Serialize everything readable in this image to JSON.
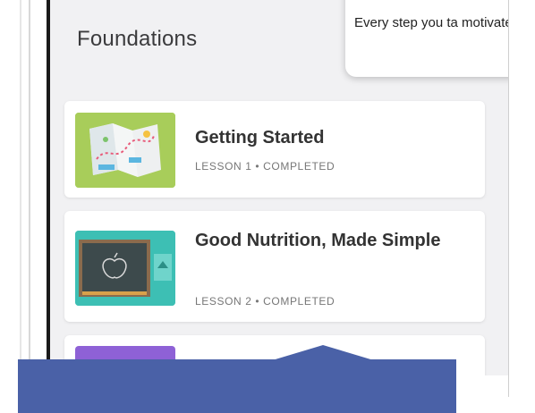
{
  "section": {
    "title": "Foundations"
  },
  "tooltip": {
    "text": "Every step you ta motivate you to g"
  },
  "lessons": [
    {
      "title": "Getting Started",
      "meta": "LESSON 1 • COMPLETED",
      "thumb_color": "#a8cd5a",
      "icon": "map-icon"
    },
    {
      "title": "Good Nutrition, Made Simple",
      "meta": "LESSON 2 • COMPLETED",
      "thumb_color": "#3dbfb4",
      "icon": "chalkboard-icon"
    },
    {
      "title": "",
      "meta": "",
      "thumb_color": "#8e61d6",
      "icon": "lesson-thumbnail-icon"
    }
  ],
  "colors": {
    "overlay": "#4a61a7",
    "screen_bg": "#f1f1f3"
  }
}
